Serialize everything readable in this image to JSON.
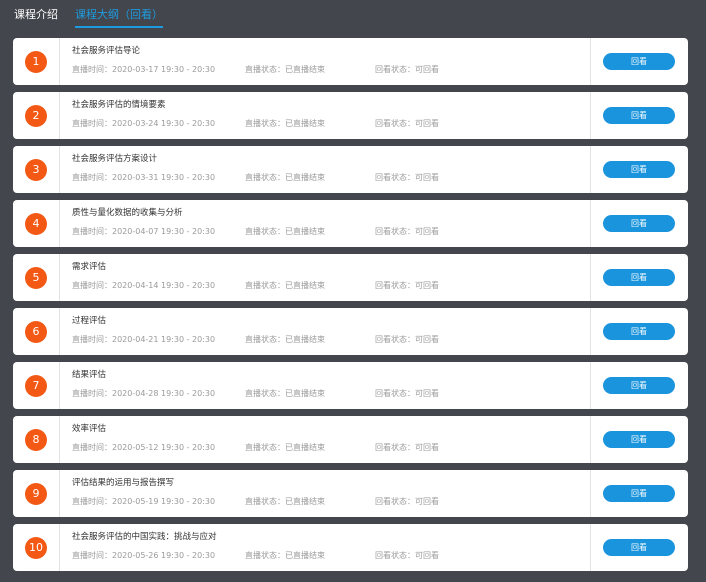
{
  "tabs": {
    "intro": "课程介绍",
    "outline": "课程大纲（回看）"
  },
  "colors": {
    "background": "#43464d",
    "accent": "#1e9be0",
    "number_badge": "#f35914",
    "button": "#1a94dc"
  },
  "lessons": [
    {
      "num": "1",
      "title": "社会服务评估导论",
      "time": "直播时间：2020-03-17 19:30 - 20:30",
      "live_status": "直播状态：已直播结束",
      "replay_status": "回看状态：可回看",
      "button": "回看"
    },
    {
      "num": "2",
      "title": "社会服务评估的情境要素",
      "time": "直播时间：2020-03-24 19:30 - 20:30",
      "live_status": "直播状态：已直播结束",
      "replay_status": "回看状态：可回看",
      "button": "回看"
    },
    {
      "num": "3",
      "title": "社会服务评估方案设计",
      "time": "直播时间：2020-03-31 19:30 - 20:30",
      "live_status": "直播状态：已直播结束",
      "replay_status": "回看状态：可回看",
      "button": "回看"
    },
    {
      "num": "4",
      "title": "质性与量化数据的收集与分析",
      "time": "直播时间：2020-04-07 19:30 - 20:30",
      "live_status": "直播状态：已直播结束",
      "replay_status": "回看状态：可回看",
      "button": "回看"
    },
    {
      "num": "5",
      "title": "需求评估",
      "time": "直播时间：2020-04-14 19:30 - 20:30",
      "live_status": "直播状态：已直播结束",
      "replay_status": "回看状态：可回看",
      "button": "回看"
    },
    {
      "num": "6",
      "title": "过程评估",
      "time": "直播时间：2020-04-21 19:30 - 20:30",
      "live_status": "直播状态：已直播结束",
      "replay_status": "回看状态：可回看",
      "button": "回看"
    },
    {
      "num": "7",
      "title": "结果评估",
      "time": "直播时间：2020-04-28 19:30 - 20:30",
      "live_status": "直播状态：已直播结束",
      "replay_status": "回看状态：可回看",
      "button": "回看"
    },
    {
      "num": "8",
      "title": "效率评估",
      "time": "直播时间：2020-05-12 19:30 - 20:30",
      "live_status": "直播状态：已直播结束",
      "replay_status": "回看状态：可回看",
      "button": "回看"
    },
    {
      "num": "9",
      "title": "评估结果的运用与报告撰写",
      "time": "直播时间：2020-05-19 19:30 - 20:30",
      "live_status": "直播状态：已直播结束",
      "replay_status": "回看状态：可回看",
      "button": "回看"
    },
    {
      "num": "10",
      "title": "社会服务评估的中国实践：挑战与应对",
      "time": "直播时间：2020-05-26 19:30 - 20:30",
      "live_status": "直播状态：已直播结束",
      "replay_status": "回看状态：可回看",
      "button": "回看"
    }
  ]
}
